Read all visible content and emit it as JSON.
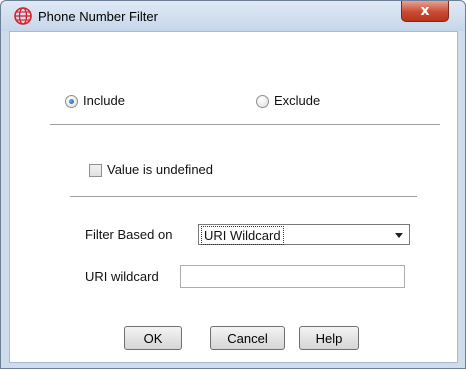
{
  "window": {
    "title": "Phone Number Filter",
    "app_icon": "globe-network-icon",
    "close_glyph": "x"
  },
  "mode": {
    "include_label": "Include",
    "exclude_label": "Exclude",
    "selected": "Include"
  },
  "undefined_checkbox": {
    "label": "Value is undefined",
    "checked": false
  },
  "filter_based_on": {
    "label": "Filter Based on",
    "selected_value": "URI Wildcard"
  },
  "uri_wildcard": {
    "label": "URI wildcard",
    "value": ""
  },
  "buttons": {
    "ok": "OK",
    "cancel": "Cancel",
    "help": "Help"
  },
  "colors": {
    "close_button": "#c94a32",
    "radio_selected": "#1d58b0",
    "app_icon": "#d81f2a"
  }
}
